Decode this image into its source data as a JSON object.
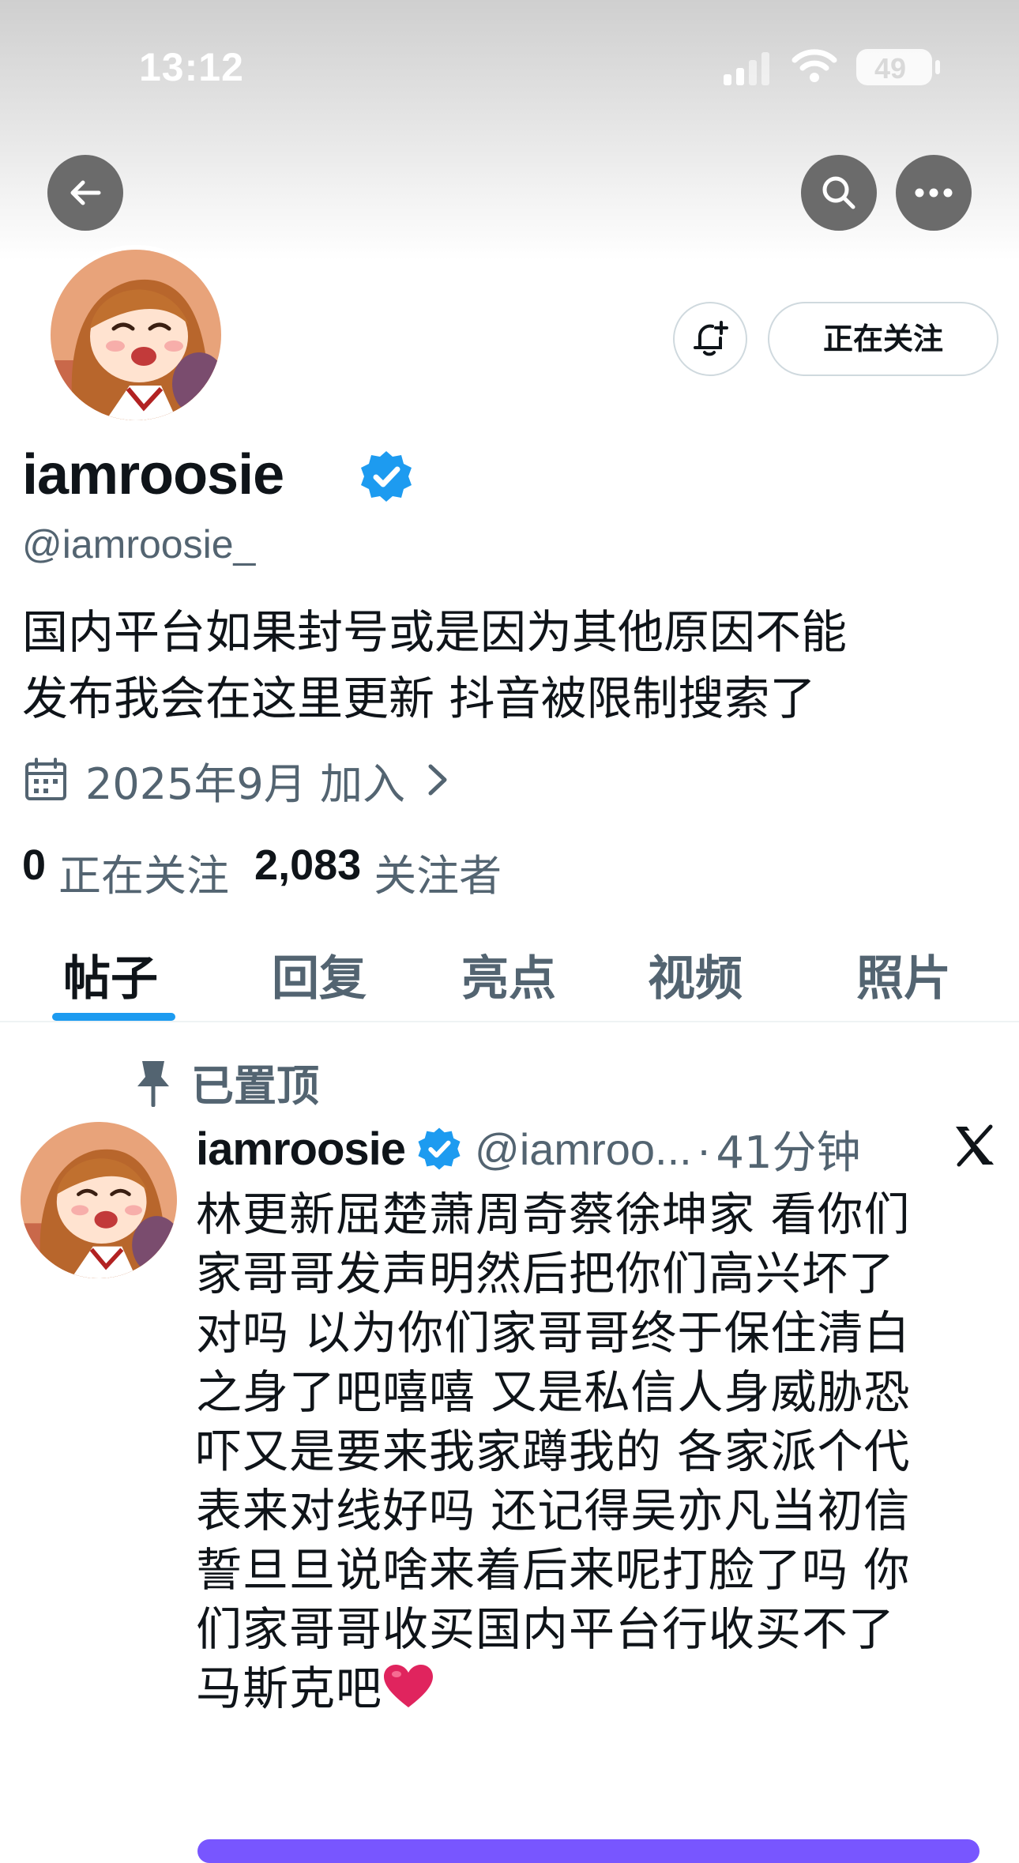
{
  "status_bar": {
    "time": "13:12",
    "battery": "49"
  },
  "profile": {
    "display_name": "iamroosie",
    "handle": "@iamroosie_",
    "bio_lines": [
      "国内平台如果封号或是因为其他原因不能",
      "发布我会在这里更新 抖音被限制搜索了"
    ],
    "joined": "2025年9月 加入",
    "following_count": "0",
    "following_label": "正在关注",
    "followers_count": "2,083",
    "followers_label": "关注者",
    "follow_button_label": "正在关注"
  },
  "tabs": [
    {
      "label": "帖子",
      "active": true
    },
    {
      "label": "回复",
      "active": false
    },
    {
      "label": "亮点",
      "active": false
    },
    {
      "label": "视频",
      "active": false
    },
    {
      "label": "照片",
      "active": false
    }
  ],
  "pinned_post": {
    "pinned_label": "已置顶",
    "author_name": "iamroosie",
    "author_handle": "@iamroo...",
    "separator": "·",
    "time": "41分钟",
    "text_lines": [
      "林更新屈楚萧周奇蔡徐坤家 看你们",
      "家哥哥发声明然后把你们高兴坏了",
      "对吗 以为你们家哥哥终于保住清白",
      "之身了吧嘻嘻 又是私信人身威胁恐",
      "吓又是要来我家蹲我的 各家派个代",
      "表来对线好吗 还记得吴亦凡当初信",
      "誓旦旦说啥来着后来呢打脸了吗 你",
      "们家哥哥收买国内平台行收买不了",
      "马斯克吧"
    ]
  },
  "colors": {
    "accent": "#1d9bf0",
    "verified": "#1d9bf0",
    "secondary_text": "#536471",
    "heart": "#e0245e"
  }
}
